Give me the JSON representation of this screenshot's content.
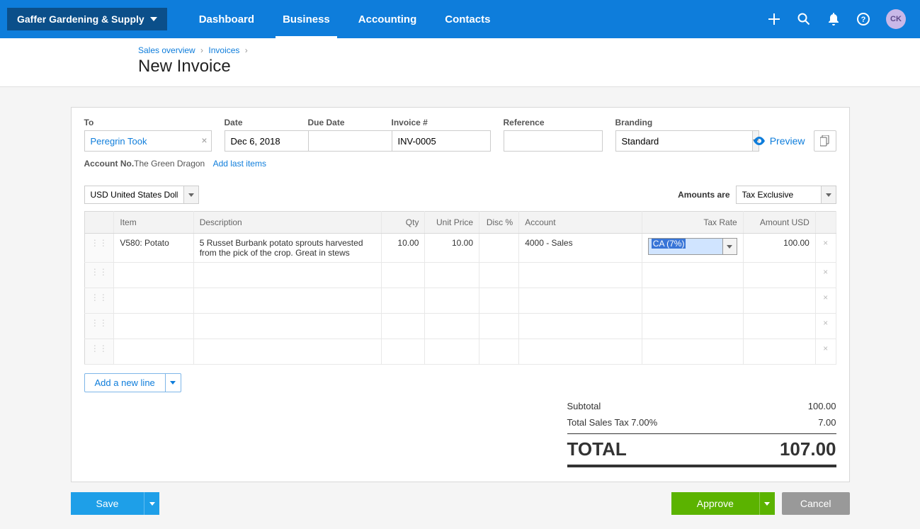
{
  "nav": {
    "org_name": "Gaffer Gardening & Supply",
    "items": [
      "Dashboard",
      "Business",
      "Accounting",
      "Contacts"
    ],
    "active_index": 1,
    "avatar_initials": "CK"
  },
  "breadcrumbs": {
    "items": [
      "Sales overview",
      "Invoices"
    ]
  },
  "page_title": "New Invoice",
  "fields": {
    "to_label": "To",
    "to_value": "Peregrin Took",
    "date_label": "Date",
    "date_value": "Dec 6, 2018",
    "due_label": "Due Date",
    "due_value": "",
    "invno_label": "Invoice #",
    "invno_value": "INV-0005",
    "ref_label": "Reference",
    "ref_value": "",
    "branding_label": "Branding",
    "branding_value": "Standard",
    "preview_label": "Preview",
    "account_no_label": "Account No.",
    "account_no_value": "The Green Dragon",
    "add_last_items": "Add last items",
    "currency": "USD United States Dollar",
    "amounts_are_label": "Amounts are",
    "amounts_are_value": "Tax Exclusive"
  },
  "table": {
    "headers": {
      "item": "Item",
      "desc": "Description",
      "qty": "Qty",
      "unit": "Unit Price",
      "disc": "Disc %",
      "acct": "Account",
      "tax": "Tax Rate",
      "amt": "Amount USD"
    },
    "rows": [
      {
        "item": "V580: Potato",
        "desc": "5 Russet Burbank potato sprouts harvested from the pick of the crop. Great in stews",
        "qty": "10.00",
        "unit": "10.00",
        "disc": "",
        "acct": "4000 - Sales",
        "tax": "CA (7%)",
        "amt": "100.00"
      },
      {
        "item": "",
        "desc": "",
        "qty": "",
        "unit": "",
        "disc": "",
        "acct": "",
        "tax": "",
        "amt": ""
      },
      {
        "item": "",
        "desc": "",
        "qty": "",
        "unit": "",
        "disc": "",
        "acct": "",
        "tax": "",
        "amt": ""
      },
      {
        "item": "",
        "desc": "",
        "qty": "",
        "unit": "",
        "disc": "",
        "acct": "",
        "tax": "",
        "amt": ""
      },
      {
        "item": "",
        "desc": "",
        "qty": "",
        "unit": "",
        "disc": "",
        "acct": "",
        "tax": "",
        "amt": ""
      }
    ],
    "add_line": "Add a new line"
  },
  "totals": {
    "subtotal_label": "Subtotal",
    "subtotal_value": "100.00",
    "tax_label": "Total Sales Tax 7.00%",
    "tax_value": "7.00",
    "total_label": "TOTAL",
    "total_value": "107.00"
  },
  "footer": {
    "save": "Save",
    "approve": "Approve",
    "cancel": "Cancel"
  }
}
